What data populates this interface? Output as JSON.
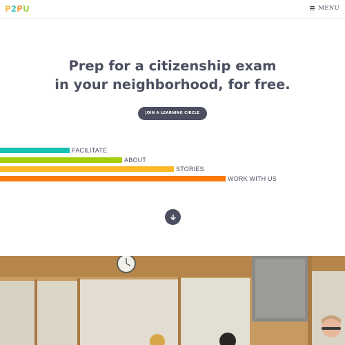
{
  "header": {
    "logo": {
      "letters": [
        "P",
        "2",
        "P",
        "U"
      ],
      "colors": [
        "#f5b73b",
        "#2fc0b3",
        "#f7942e",
        "#9ccf3c"
      ]
    },
    "menu_label": "MENU",
    "menu_icon": "hamburger-icon"
  },
  "hero": {
    "headline_line1": "Prep for a citizenship exam",
    "headline_line2": "in your neighborhood, for free.",
    "cta_label": "JOIN A LEARNING CIRCLE"
  },
  "nav": {
    "items": [
      {
        "label": "FACILITATE",
        "color": "#17c1b2"
      },
      {
        "label": "ABOUT",
        "color": "#a6cd0a"
      },
      {
        "label": "STORIES",
        "color": "#fbb726"
      },
      {
        "label": "WORK WITH US",
        "color": "#fd7a08"
      }
    ]
  },
  "scroll_button_icon": "arrow-down-icon",
  "photo": {
    "description_icon": "classroom-photo"
  }
}
